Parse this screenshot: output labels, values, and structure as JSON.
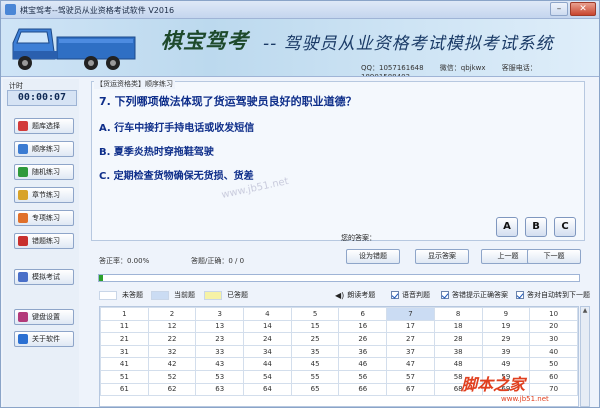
{
  "window": {
    "title": "棋宝驾考--驾驶员从业资格考试软件 V2016"
  },
  "banner": {
    "logo": "棋宝驾考",
    "slogan": "-- 驾驶员从业资格考试模拟考试系统",
    "qq": "QQ：1057161648",
    "wechat": "微信：qbjkwx",
    "phone": "客服电话：18901588403"
  },
  "sidebar": {
    "timer_label": "计时",
    "timer": "00:00:07",
    "items": [
      {
        "label": "题库选择",
        "icon": "book-icon",
        "color": "#d23b3b"
      },
      {
        "label": "顺序练习",
        "icon": "list-icon",
        "color": "#3b7bd2"
      },
      {
        "label": "随机练习",
        "icon": "shuffle-icon",
        "color": "#2f9a3b"
      },
      {
        "label": "章节练习",
        "icon": "chapter-icon",
        "color": "#d8a32a"
      },
      {
        "label": "专项练习",
        "icon": "target-icon",
        "color": "#e0702a"
      },
      {
        "label": "错题练习",
        "icon": "error-icon",
        "color": "#c8302e"
      },
      {
        "label": "模拟考试",
        "icon": "exam-icon",
        "color": "#4a6fc8"
      },
      {
        "label": "键盘设置",
        "icon": "keyboard-icon",
        "color": "#b23a7a"
      },
      {
        "label": "关于软件",
        "icon": "info-icon",
        "color": "#2a6fd2"
      }
    ]
  },
  "question": {
    "breadcrumb": "【货运资格类】顺序练习",
    "text": "7. 下列哪项做法体现了货运驾驶员良好的职业道德？",
    "options": [
      "A. 行车中接打手持电话或收发短信",
      "B. 夏季炎热时穿拖鞋驾驶",
      "C. 定期检查货物确保无货损、货差"
    ],
    "answer_label": "您的答案：",
    "choices": [
      "A",
      "B",
      "C"
    ],
    "watermark": "www.jb51.net"
  },
  "stats": {
    "accuracy": "答正率：0.00%",
    "answered": "答题/正确：0 / 0"
  },
  "actions": {
    "set_wrong": "设为错题",
    "show_answer": "显示答案",
    "prev": "上一题",
    "next": "下一题"
  },
  "progress": {
    "value": 0.008,
    "color": "#2ca02c"
  },
  "legend": {
    "unanswered": "未答题",
    "current": "当前题",
    "answered": "已答题",
    "colors": {
      "unanswered": "#ffffff",
      "current": "#cbdcf3",
      "answered": "#f6f2a6"
    }
  },
  "options": {
    "read_aloud": "朗读考题",
    "voice_judge": "语音判题",
    "show_correct": "答错提示正确答案",
    "auto_next": "答对自动转到下一题"
  },
  "grid": {
    "current": 7,
    "rows": [
      [
        "1",
        "2",
        "3",
        "4",
        "5",
        "6",
        "7",
        "8",
        "9",
        "10"
      ],
      [
        "11",
        "12",
        "13",
        "14",
        "15",
        "16",
        "17",
        "18",
        "19",
        "20"
      ],
      [
        "21",
        "22",
        "23",
        "24",
        "25",
        "26",
        "27",
        "28",
        "29",
        "30"
      ],
      [
        "31",
        "32",
        "33",
        "34",
        "35",
        "36",
        "37",
        "38",
        "39",
        "40"
      ],
      [
        "41",
        "42",
        "43",
        "44",
        "45",
        "46",
        "47",
        "48",
        "49",
        "50"
      ],
      [
        "51",
        "52",
        "53",
        "54",
        "55",
        "56",
        "57",
        "58",
        "59",
        "60"
      ],
      [
        "61",
        "62",
        "63",
        "64",
        "65",
        "66",
        "67",
        "68",
        "69",
        "70"
      ]
    ]
  },
  "corner_watermark": {
    "text": "脚本之家",
    "url": "www.jb51.net"
  }
}
